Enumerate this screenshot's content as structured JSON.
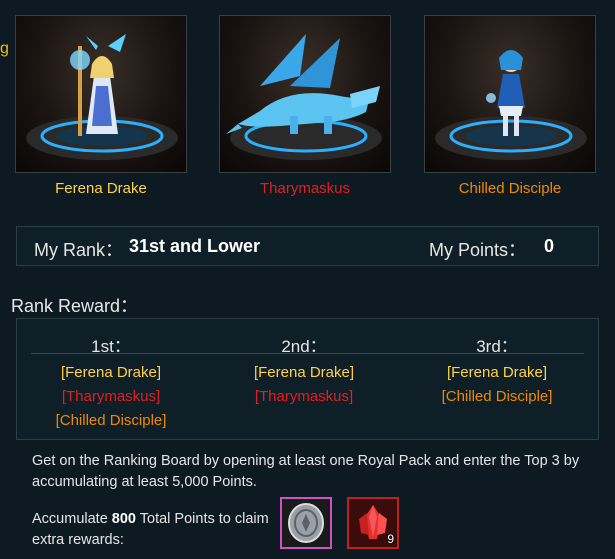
{
  "clipped_text": "g",
  "heroes": [
    {
      "name": "Ferena Drake",
      "color": "#ffd24a",
      "icon": "ice-mage-girl-icon"
    },
    {
      "name": "Tharymaskus",
      "color": "#e02020",
      "icon": "ice-dragon-icon"
    },
    {
      "name": "Chilled Disciple",
      "color": "#f08a00",
      "icon": "ice-maiden-icon"
    }
  ],
  "my_rank": {
    "label": "My Rank：",
    "value": "31st and Lower"
  },
  "my_points": {
    "label": "My Points：",
    "value": "0"
  },
  "rank_reward": {
    "title": "Rank Reward：",
    "columns": [
      {
        "header": "1st：",
        "rewards": [
          "[Ferena Drake]",
          "[Tharymaskus]",
          "[Chilled Disciple]"
        ]
      },
      {
        "header": "2nd：",
        "rewards": [
          "[Ferena Drake]",
          "[Tharymaskus]"
        ]
      },
      {
        "header": "3rd：",
        "rewards": [
          "[Ferena Drake]",
          "[Chilled Disciple]"
        ]
      }
    ]
  },
  "info_text": "Get on the Ranking Board by opening at least one Royal Pack and enter the Top 3 by accumulating at least 5,000 Points.",
  "accumulate": {
    "prefix": "Accumulate ",
    "points": "800",
    "suffix": " Total Points to claim extra rewards:"
  },
  "extra_rewards": [
    {
      "icon": "silver-coin-icon",
      "quantity": ""
    },
    {
      "icon": "red-crystal-icon",
      "quantity": "9"
    }
  ]
}
